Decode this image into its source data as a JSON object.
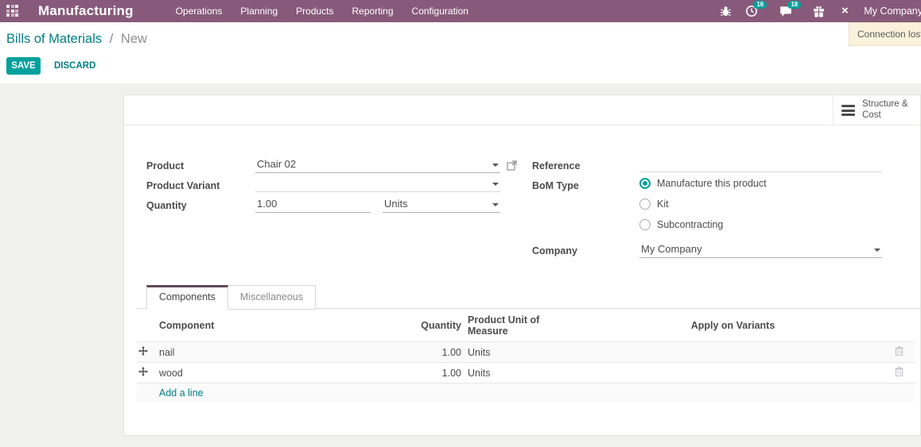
{
  "navbar": {
    "app_name": "Manufacturing",
    "menus": [
      "Operations",
      "Planning",
      "Products",
      "Reporting",
      "Configuration"
    ],
    "activity_badge": "16",
    "message_badge": "18",
    "company": "My Company"
  },
  "toast": {
    "text": "Connection lost."
  },
  "breadcrumb": {
    "parent": "Bills of Materials",
    "separator": "/",
    "current": "New"
  },
  "actions": {
    "save": "SAVE",
    "discard": "DISCARD"
  },
  "sheet": {
    "button_box": {
      "structure_cost": "Structure & Cost"
    },
    "fields": {
      "product": {
        "label": "Product",
        "value": "Chair 02"
      },
      "product_variant": {
        "label": "Product Variant",
        "value": ""
      },
      "quantity": {
        "label": "Quantity",
        "value": "1.00",
        "uom": "Units"
      },
      "reference": {
        "label": "Reference",
        "value": ""
      },
      "bom_type": {
        "label": "BoM Type",
        "options": [
          {
            "label": "Manufacture this product",
            "selected": true
          },
          {
            "label": "Kit",
            "selected": false
          },
          {
            "label": "Subcontracting",
            "selected": false
          }
        ]
      },
      "company": {
        "label": "Company",
        "value": "My Company"
      }
    },
    "tabs": [
      {
        "label": "Components",
        "active": true
      },
      {
        "label": "Miscellaneous",
        "active": false
      }
    ],
    "table": {
      "headers": [
        "Component",
        "Quantity",
        "Product Unit of Measure",
        "Apply on Variants"
      ],
      "rows": [
        {
          "component": "nail",
          "quantity": "1.00",
          "uom": "Units"
        },
        {
          "component": "wood",
          "quantity": "1.00",
          "uom": "Units"
        }
      ],
      "add_line": "Add a line"
    }
  },
  "colors": {
    "navbar_bg": "#875A7B",
    "accent": "#00A09D",
    "link": "#017E84",
    "toast_bg": "#FBF2DC"
  }
}
